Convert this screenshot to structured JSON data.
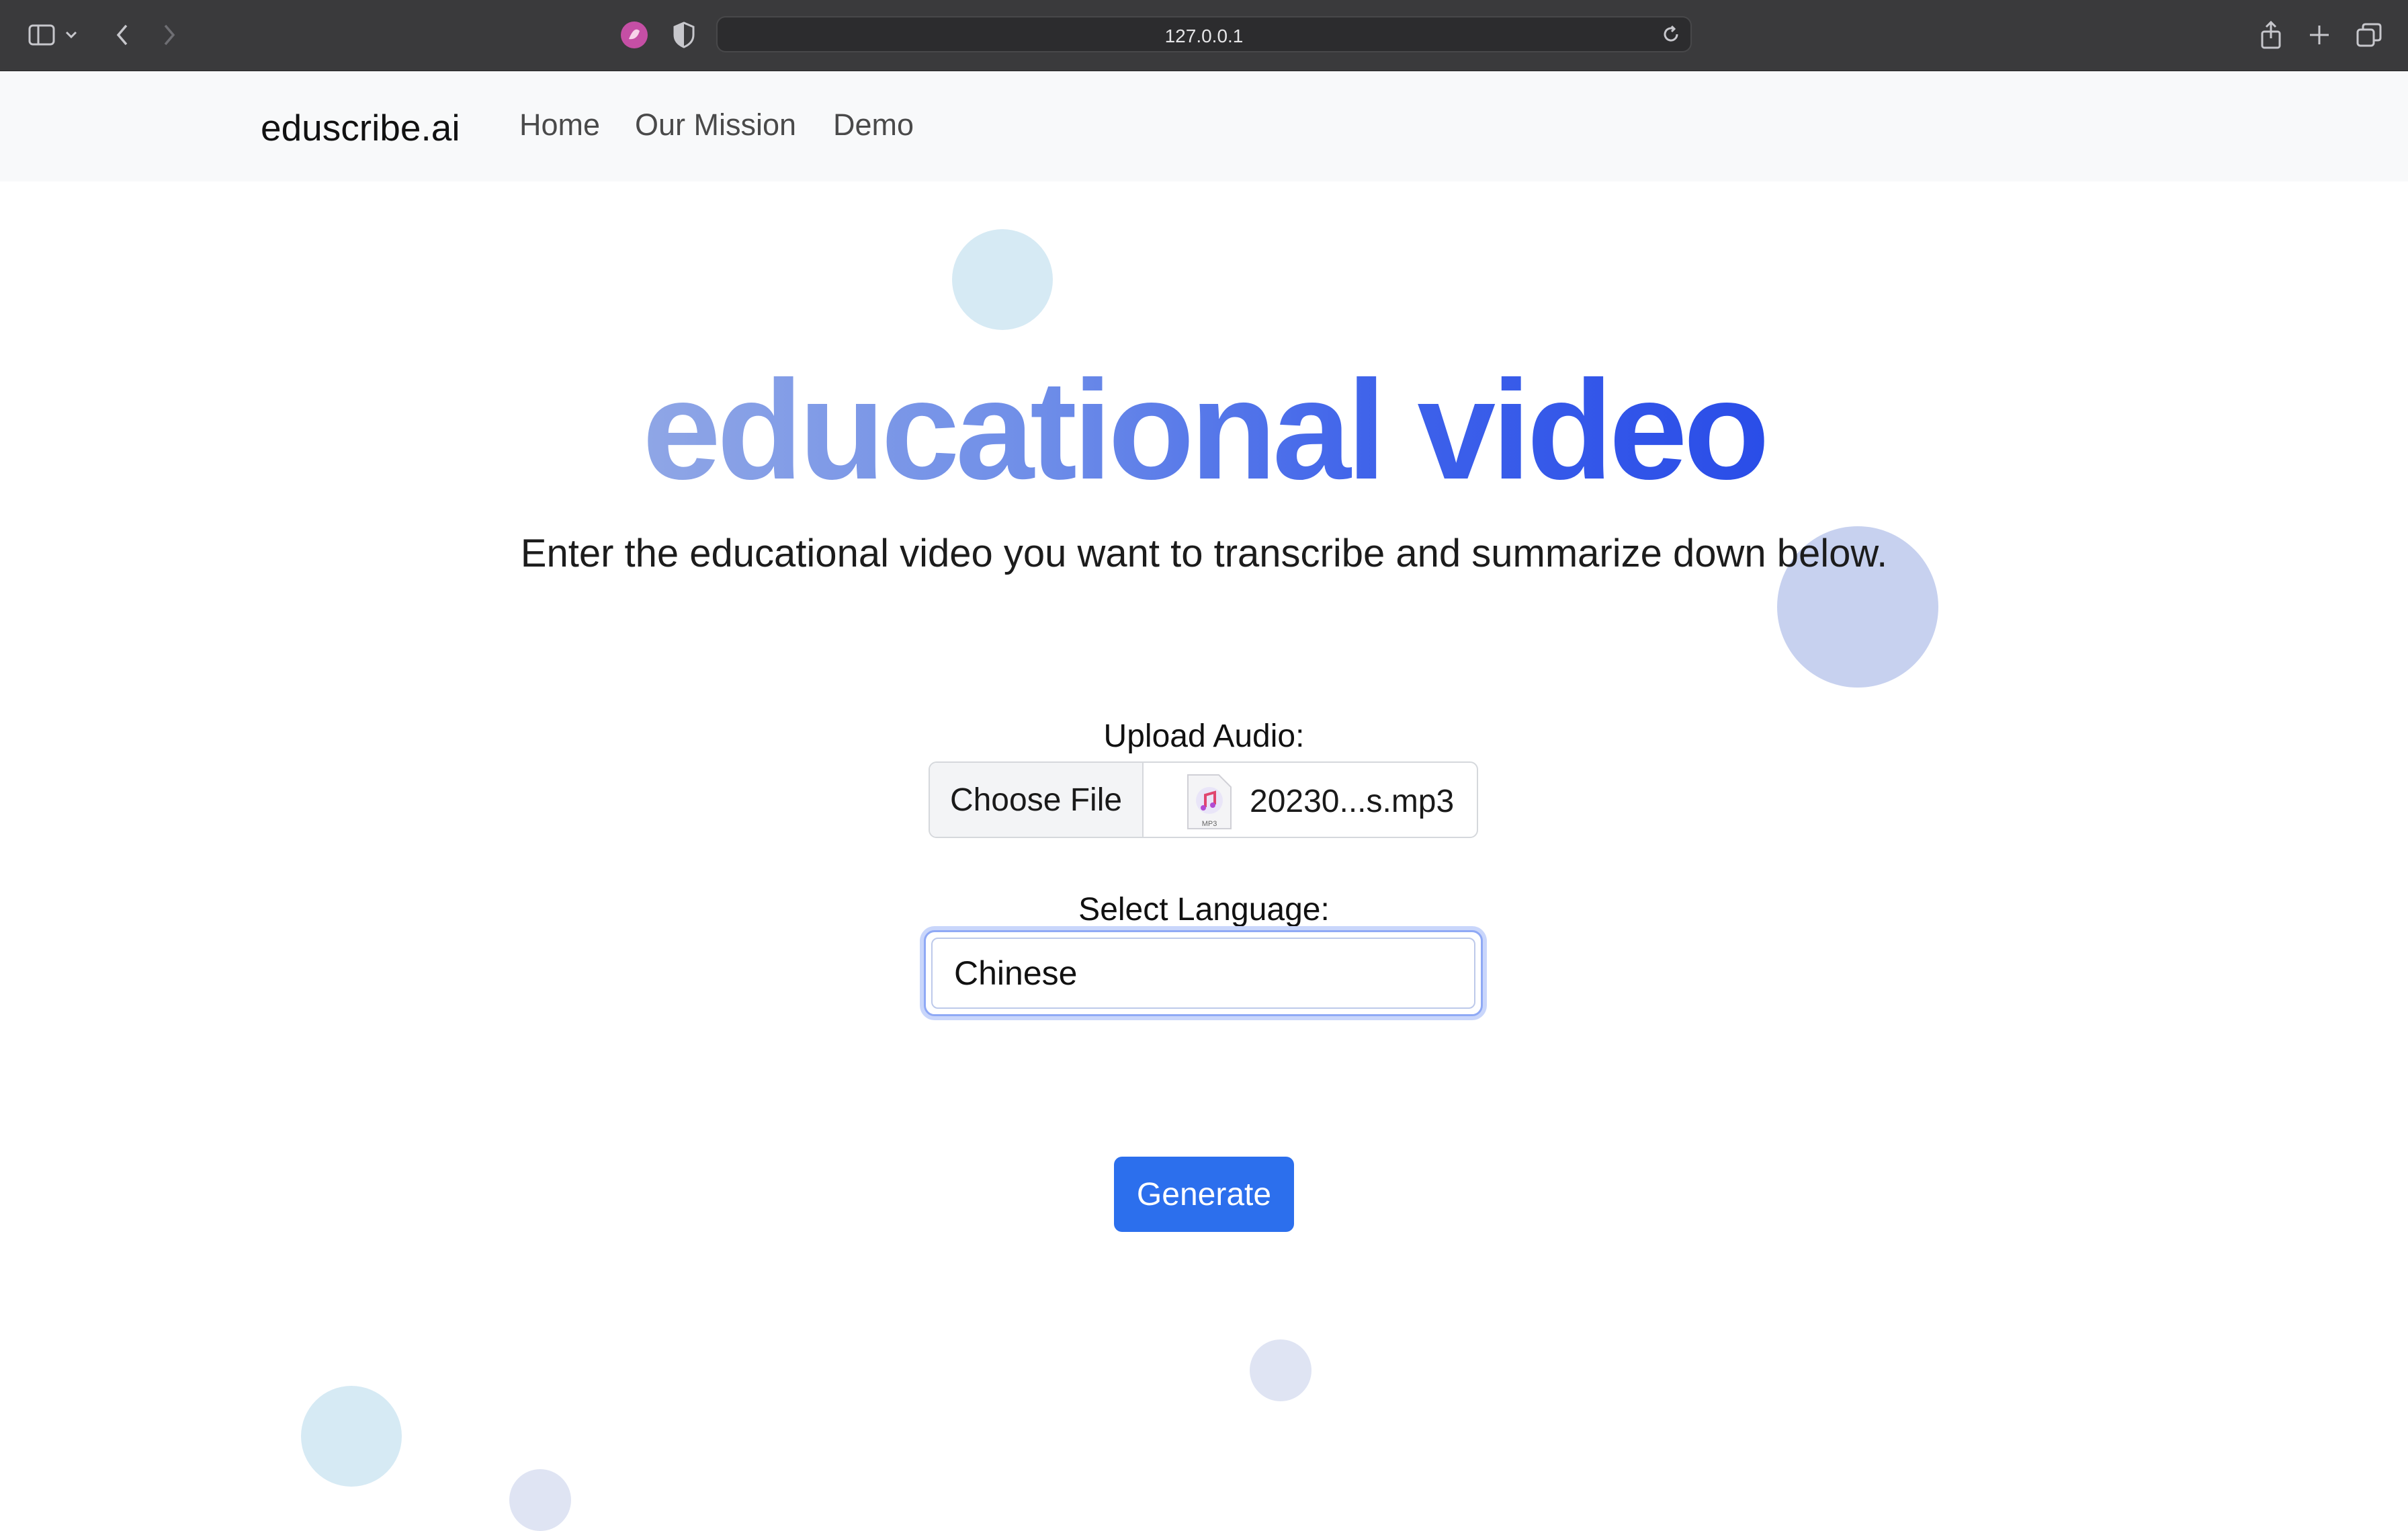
{
  "browser": {
    "url": "127.0.0.1",
    "icons": [
      "sidebar-icon",
      "chevron-down-icon",
      "back-icon",
      "forward-icon",
      "extension-icon",
      "shield-icon",
      "reload-icon",
      "share-icon",
      "new-tab-icon",
      "tabs-overview-icon"
    ]
  },
  "navbar": {
    "brand": "eduscribe.ai",
    "links": [
      "Home",
      "Our Mission",
      "Demo"
    ]
  },
  "hero": {
    "title": "educational video",
    "subtitle": "Enter the educational video you want to transcribe and summarize down below."
  },
  "form": {
    "upload_label": "Upload Audio:",
    "choose_file_label": "Choose File",
    "file_name": "20230...s.mp3",
    "file_icon_text": "MP3",
    "language_label": "Select Language:",
    "language_selected": "Chinese",
    "generate_label": "Generate"
  },
  "colors": {
    "accent": "#2c6fed",
    "title_gradient_start": "#8fa6e6",
    "title_gradient_end": "#2a4de8",
    "bubble_light_blue": "#d6eaf4",
    "bubble_periwinkle": "#c7d1ef"
  }
}
